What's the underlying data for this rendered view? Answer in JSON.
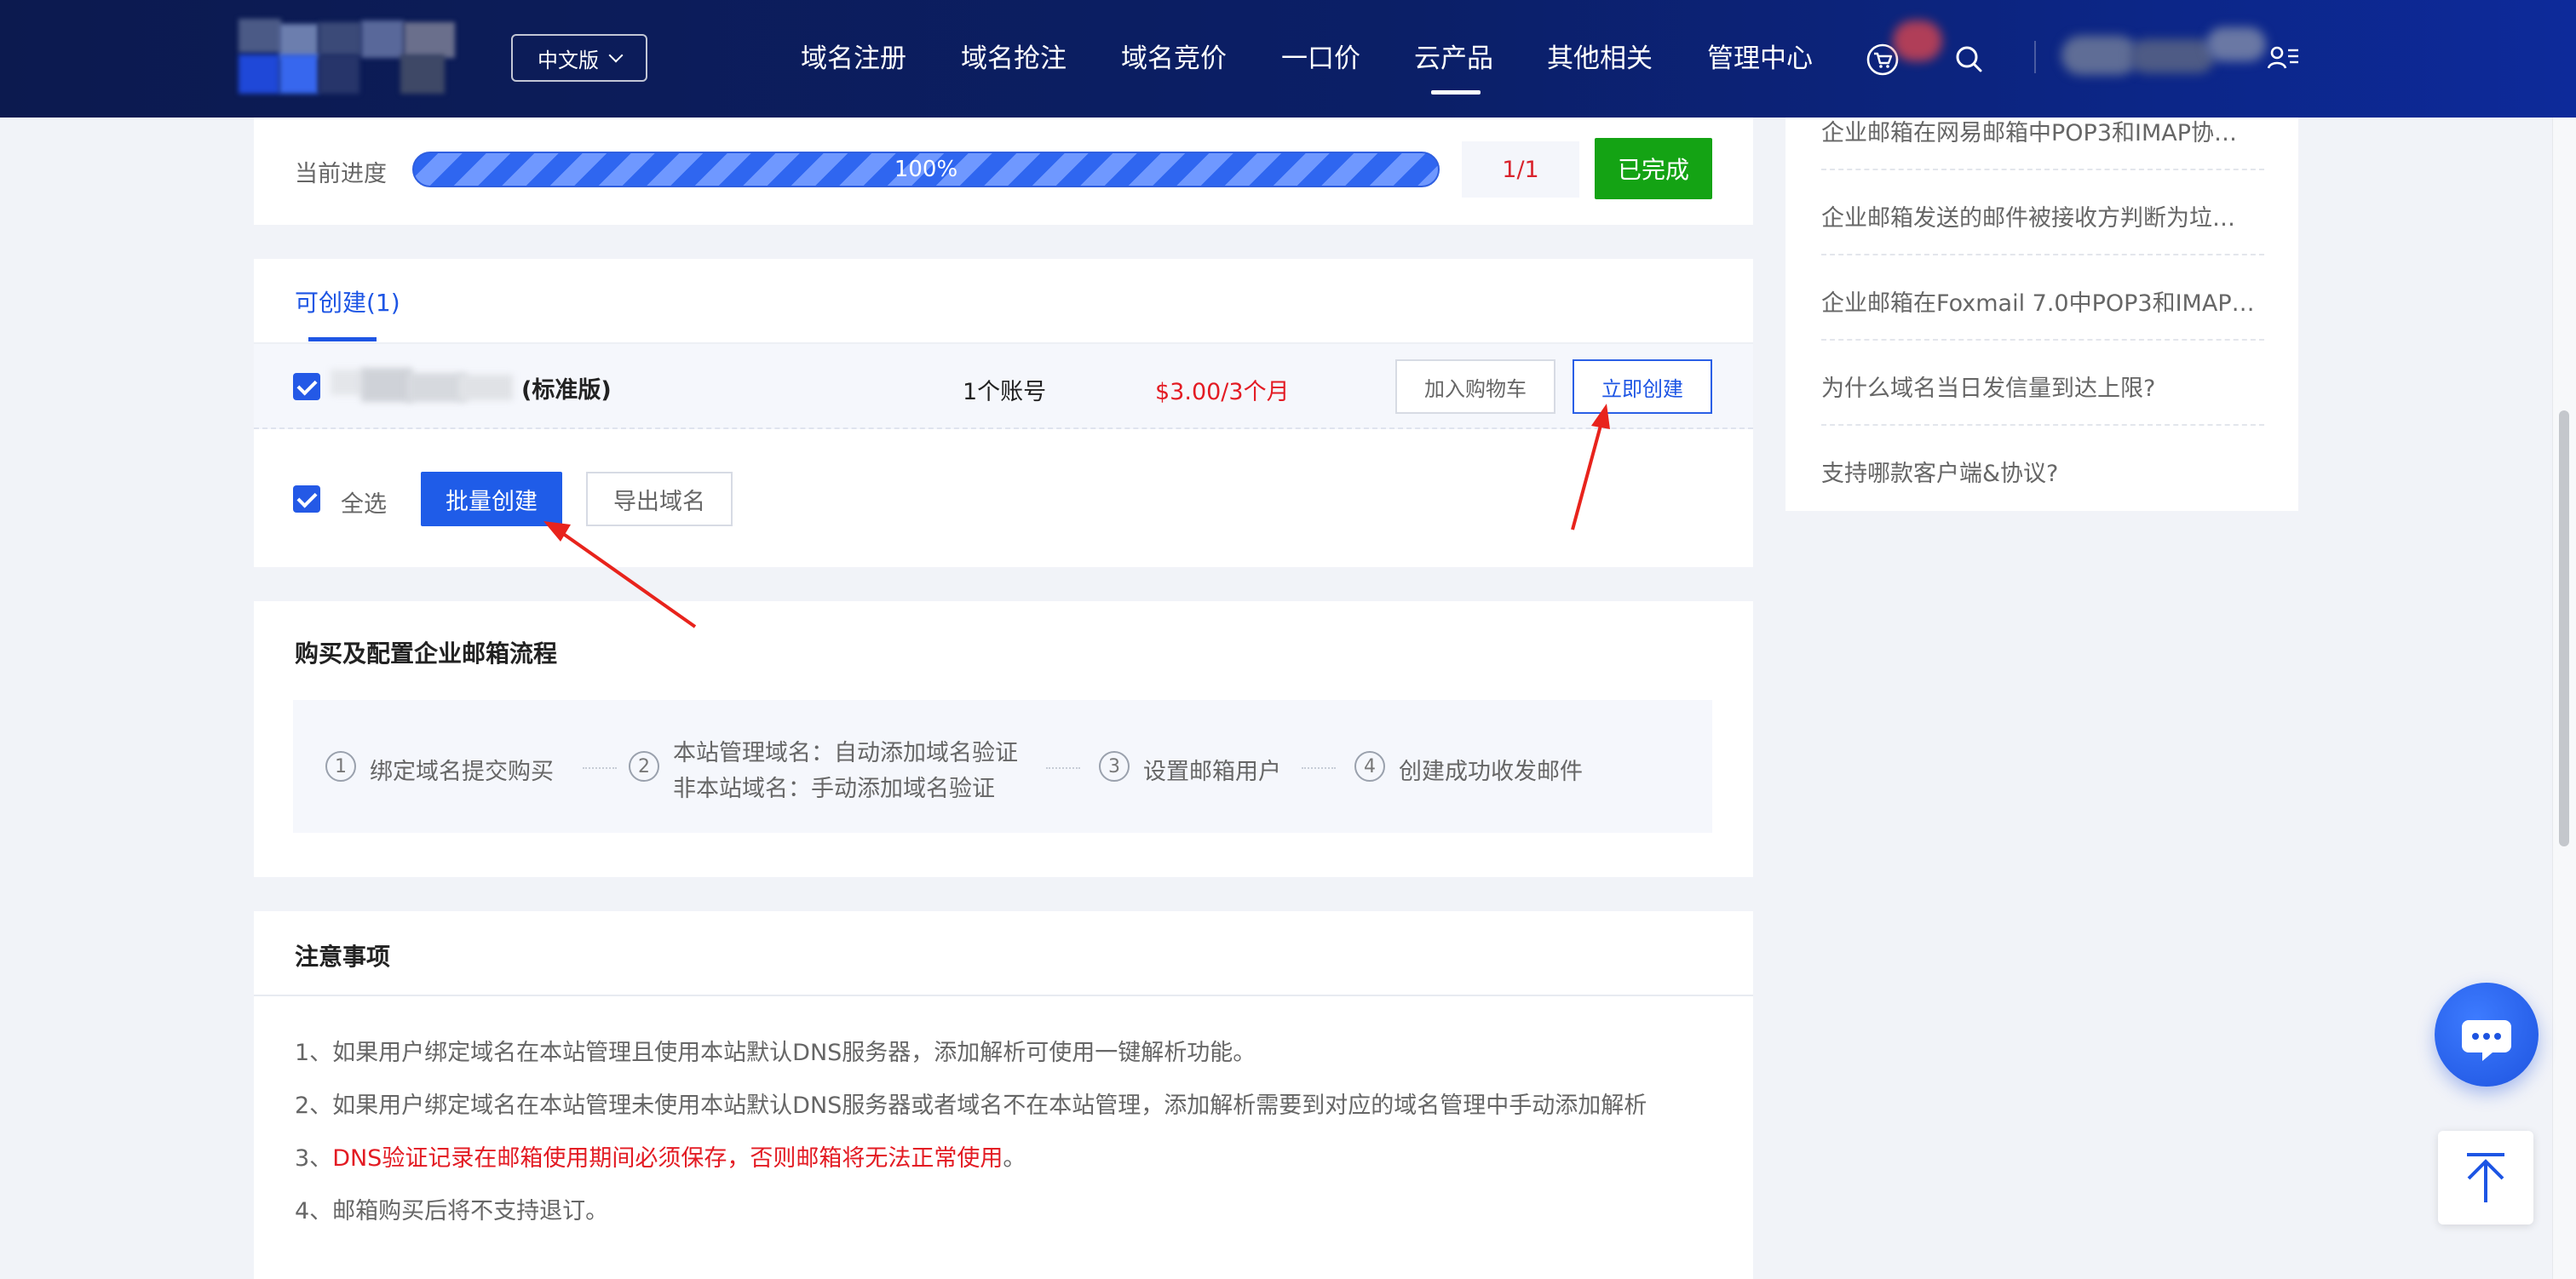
{
  "header": {
    "language": "中文版",
    "nav": [
      "域名注册",
      "域名抢注",
      "域名竞价",
      "一口价",
      "云产品",
      "其他相关",
      "管理中心"
    ],
    "active_nav": "云产品"
  },
  "progress": {
    "label": "当前进度",
    "percent_text": "100%",
    "fraction": 1.0,
    "count": "1/1",
    "status_button": "已完成"
  },
  "creatable": {
    "tab_label": "可创建(1)",
    "item": {
      "edition": "(标准版)",
      "accounts": "1个账号",
      "price": "$3.00/3个月",
      "add_to_cart": "加入购物车",
      "create_now": "立即创建"
    },
    "select_all": "全选",
    "batch_create": "批量创建",
    "export_domains": "导出域名"
  },
  "flow": {
    "title": "购买及配置企业邮箱流程",
    "steps": [
      {
        "num": "1",
        "text": "绑定域名提交购买"
      },
      {
        "num": "2",
        "line1": "本站管理域名：自动添加域名验证",
        "line2": "非本站域名：手动添加域名验证"
      },
      {
        "num": "3",
        "text": "设置邮箱用户"
      },
      {
        "num": "4",
        "text": "创建成功收发邮件"
      }
    ]
  },
  "notes": {
    "title": "注意事项",
    "lines": [
      "1、如果用户绑定域名在本站管理且使用本站默认DNS服务器，添加解析可使用一键解析功能。",
      "2、如果用户绑定域名在本站管理未使用本站默认DNS服务器或者域名不在本站管理，添加解析需要到对应的域名管理中手动添加解析",
      "4、邮箱购买后将不支持退订。"
    ],
    "line3_prefix": "3、",
    "line3_red": "DNS验证记录在邮箱使用期间必须保存，否则邮箱将无法正常使用",
    "line3_suffix": "。"
  },
  "sidebar": {
    "links": [
      "企业邮箱在网易邮箱中POP3和IMAP协…",
      "企业邮箱发送的邮件被接收方判断为垃…",
      "企业邮箱在Foxmail 7.0中POP3和IMAP…",
      "为什么域名当日发信量到达上限?",
      "支持哪款客户端&协议?"
    ]
  },
  "colors": {
    "nav_bg": "#0b1f67",
    "accent": "#1f5ce8",
    "done_green": "#14a314",
    "price_red": "#e31b23"
  },
  "icons": [
    "chevron-down-icon",
    "cart-icon",
    "search-icon",
    "user-menu-icon",
    "checkbox-checked-icon",
    "chat-icon",
    "back-to-top-icon"
  ]
}
